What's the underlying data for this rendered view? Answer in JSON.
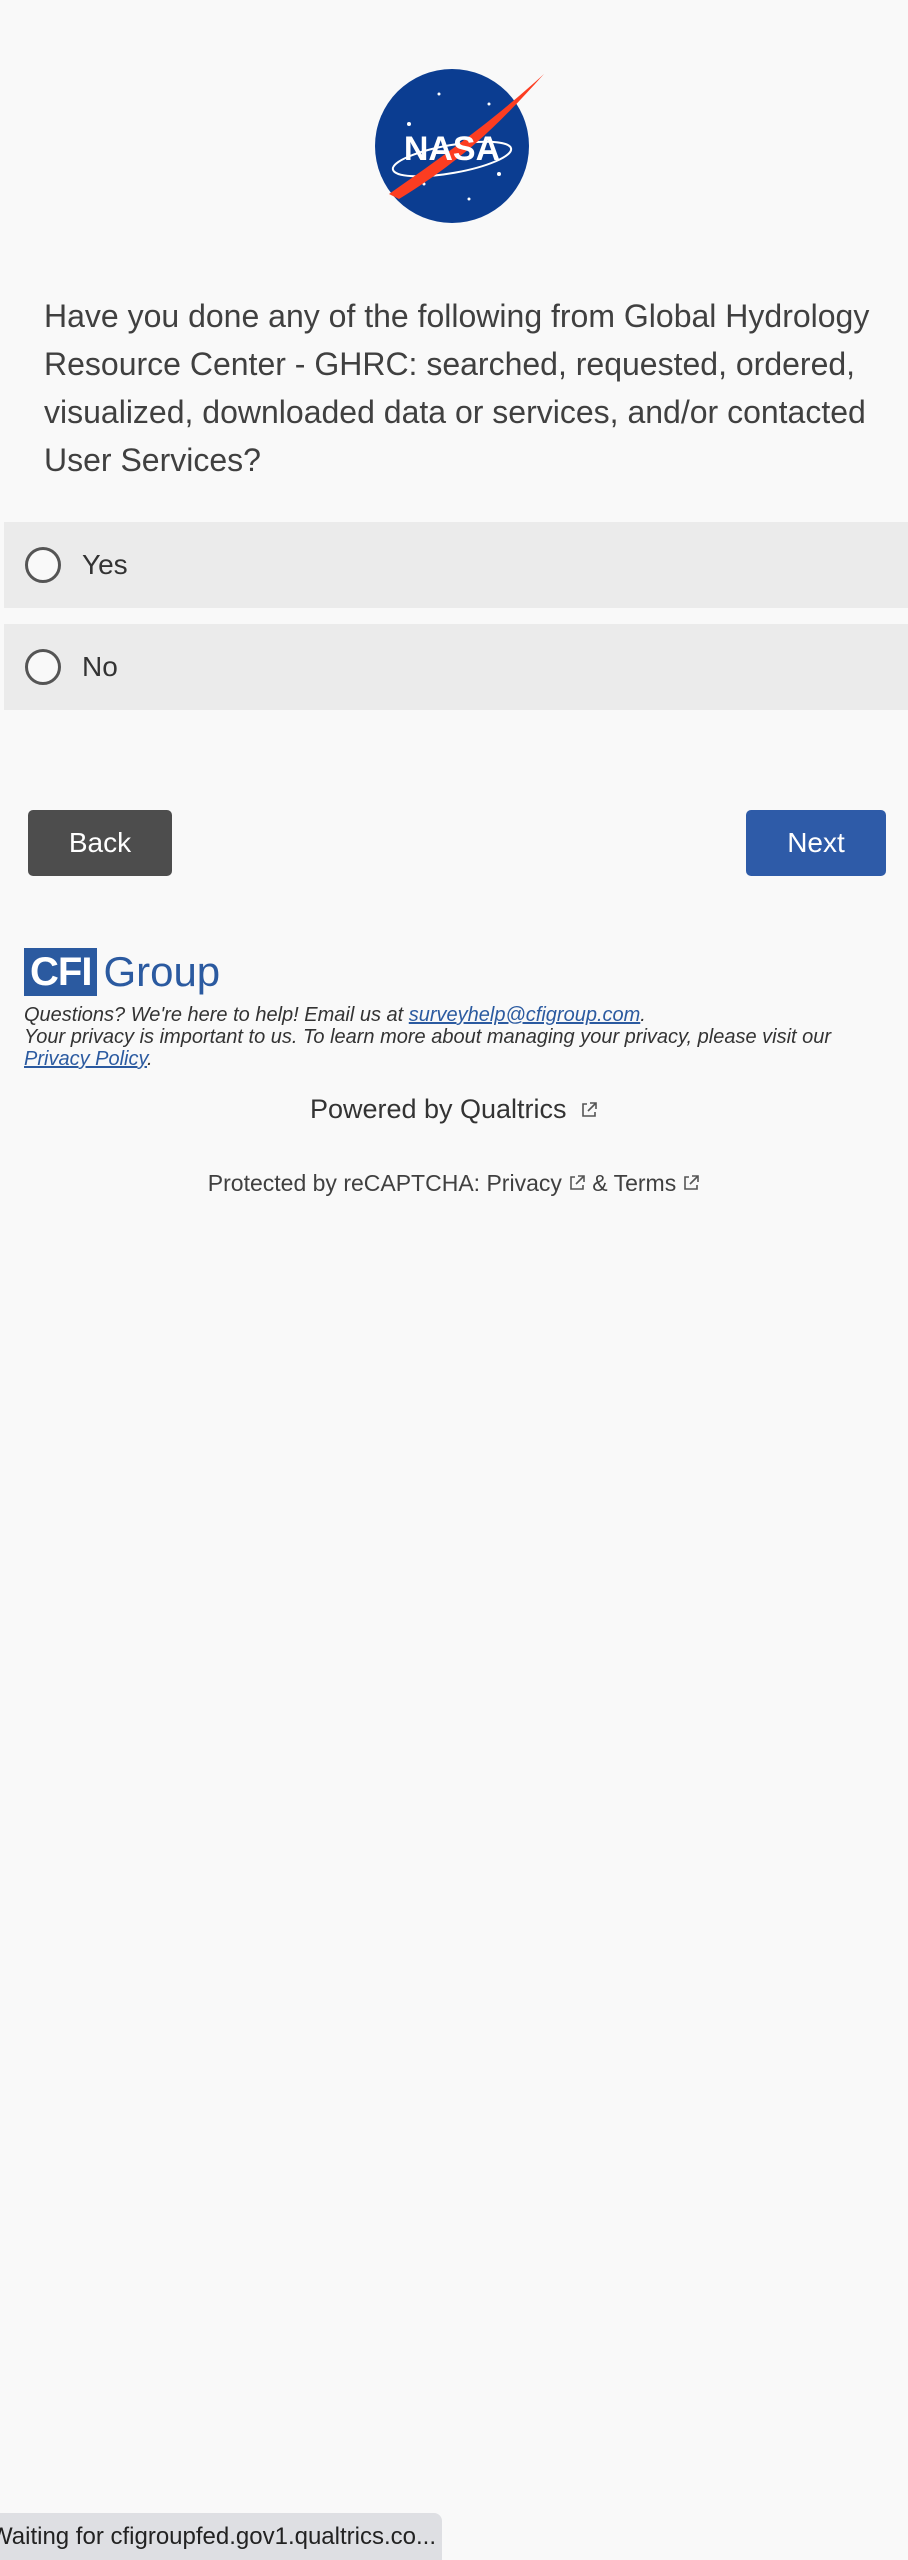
{
  "logo": {
    "name": "nasa-logo",
    "text": "NASA"
  },
  "question": {
    "text": "Have you done any of the following from Global Hydrology Resource Center - GHRC: searched, requested, ordered, visualized, downloaded data or services, and/or contacted User Services?"
  },
  "choices": [
    {
      "label": "Yes"
    },
    {
      "label": "No"
    }
  ],
  "nav": {
    "back_label": "Back",
    "next_label": "Next"
  },
  "footer": {
    "brand_box": "CFI",
    "brand_word": "Group",
    "help_prefix": "Questions? We're here to help! Email us at ",
    "email": "surveyhelp@cfigroup.com",
    "help_suffix": ".",
    "privacy_prefix": "Your privacy is important to us. To learn more about managing your privacy, please visit our ",
    "privacy_link": "Privacy Policy",
    "privacy_suffix": "."
  },
  "powered_by": "Powered by Qualtrics",
  "recaptcha": {
    "prefix": "Protected by reCAPTCHA: ",
    "privacy": "Privacy",
    "amp": " & ",
    "terms": "Terms"
  },
  "status_bar": "Waiting for cfigroupfed.gov1.qualtrics.co...",
  "colors": {
    "background": "#f9f9f9",
    "choice_bg": "#ebebeb",
    "back_button": "#4d4d4d",
    "next_button": "#2e5ba8",
    "brand_blue": "#2b5aa0",
    "nasa_blue": "#0b3d91",
    "nasa_red": "#fc3d21"
  }
}
